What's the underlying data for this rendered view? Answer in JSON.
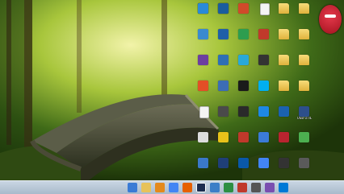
{
  "desktop": {
    "badge_text": "",
    "icons": [
      {
        "label": "",
        "type": "app",
        "color": "#2a6ab0"
      },
      {
        "label": "",
        "type": "app",
        "color": "#e48a1c"
      },
      {
        "label": "",
        "type": "app",
        "color": "#d04a2a"
      },
      {
        "label": "",
        "type": "doc",
        "color": "#f4f4f4"
      },
      {
        "label": "",
        "type": "folder",
        "color": "#f0c95a"
      },
      {
        "label": "",
        "type": "folder",
        "color": "#f0c95a"
      },
      {
        "label": "",
        "type": "app",
        "color": "#3a8ad0"
      },
      {
        "label": "",
        "type": "app",
        "color": "#1f5fa8"
      },
      {
        "label": "",
        "type": "app",
        "color": "#2d9d4f"
      },
      {
        "label": "",
        "type": "app",
        "color": "#c0392b"
      },
      {
        "label": "",
        "type": "folder",
        "color": "#f0c95a"
      },
      {
        "label": "",
        "type": "folder",
        "color": "#f0c95a"
      },
      {
        "label": "",
        "type": "app",
        "color": "#6c3fa0"
      },
      {
        "label": "",
        "type": "app",
        "color": "#2f6fb5"
      },
      {
        "label": "",
        "type": "app",
        "color": "#29a8d9"
      },
      {
        "label": "",
        "type": "app",
        "color": "#333333"
      },
      {
        "label": "",
        "type": "folder",
        "color": "#f0c95a"
      },
      {
        "label": "",
        "type": "folder",
        "color": "#f0c95a"
      },
      {
        "label": "",
        "type": "app",
        "color": "#e34f26"
      },
      {
        "label": "",
        "type": "app",
        "color": "#3c6db5"
      },
      {
        "label": "",
        "type": "app",
        "color": "#1a1a1a"
      },
      {
        "label": "",
        "type": "app",
        "color": "#00aff0"
      },
      {
        "label": "",
        "type": "folder",
        "color": "#f0c95a"
      },
      {
        "label": "",
        "type": "folder",
        "color": "#f0c95a"
      },
      {
        "label": "",
        "type": "doc",
        "color": "#f4f4f4"
      },
      {
        "label": "",
        "type": "app",
        "color": "#4a4a4a"
      },
      {
        "label": "",
        "type": "app",
        "color": "#2a2a2a"
      },
      {
        "label": "",
        "type": "app",
        "color": "#1e88e5"
      },
      {
        "label": "",
        "type": "app",
        "color": "#1b62b0"
      },
      {
        "label": "USB UTIL",
        "type": "app",
        "color": "#2d4f8a"
      },
      {
        "label": "",
        "type": "app",
        "color": "#dddddd"
      },
      {
        "label": "",
        "type": "app",
        "color": "#e8c21a"
      },
      {
        "label": "",
        "type": "app",
        "color": "#c0392b"
      },
      {
        "label": "",
        "type": "app",
        "color": "#3b7bd6"
      },
      {
        "label": "",
        "type": "app",
        "color": "#b8242f"
      },
      {
        "label": "",
        "type": "app",
        "color": "#4caf50"
      },
      {
        "label": "",
        "type": "app",
        "color": "#3a78c8"
      },
      {
        "label": "",
        "type": "app",
        "color": "#1f3f78"
      },
      {
        "label": "",
        "type": "app",
        "color": "#0a58a8"
      },
      {
        "label": "",
        "type": "app",
        "color": "#4285f4"
      },
      {
        "label": "",
        "type": "app",
        "color": "#333333"
      },
      {
        "label": "",
        "type": "app",
        "color": "#5a5a5a"
      },
      {
        "label": "",
        "type": "app",
        "color": "#2a8ad8"
      },
      {
        "label": "",
        "type": "app",
        "color": "#1a5d9e"
      }
    ]
  },
  "taskbar": {
    "clock_time": "",
    "clock_date": "",
    "items": [
      {
        "name": "start-button",
        "color": "#3a7bd5"
      },
      {
        "name": "taskbar-explorer",
        "color": "#e7c25a"
      },
      {
        "name": "taskbar-media",
        "color": "#e48a1c"
      },
      {
        "name": "taskbar-chrome",
        "color": "#4285f4"
      },
      {
        "name": "taskbar-firefox",
        "color": "#e66000"
      },
      {
        "name": "taskbar-photoshop",
        "color": "#1d2c4f"
      },
      {
        "name": "taskbar-app-1",
        "color": "#3c7ec7"
      },
      {
        "name": "taskbar-app-2",
        "color": "#2d8f43"
      },
      {
        "name": "taskbar-app-3",
        "color": "#c0392b"
      },
      {
        "name": "taskbar-app-4",
        "color": "#555555"
      },
      {
        "name": "taskbar-app-5",
        "color": "#7a4fb0"
      },
      {
        "name": "taskbar-app-6",
        "color": "#0079d6"
      }
    ]
  }
}
